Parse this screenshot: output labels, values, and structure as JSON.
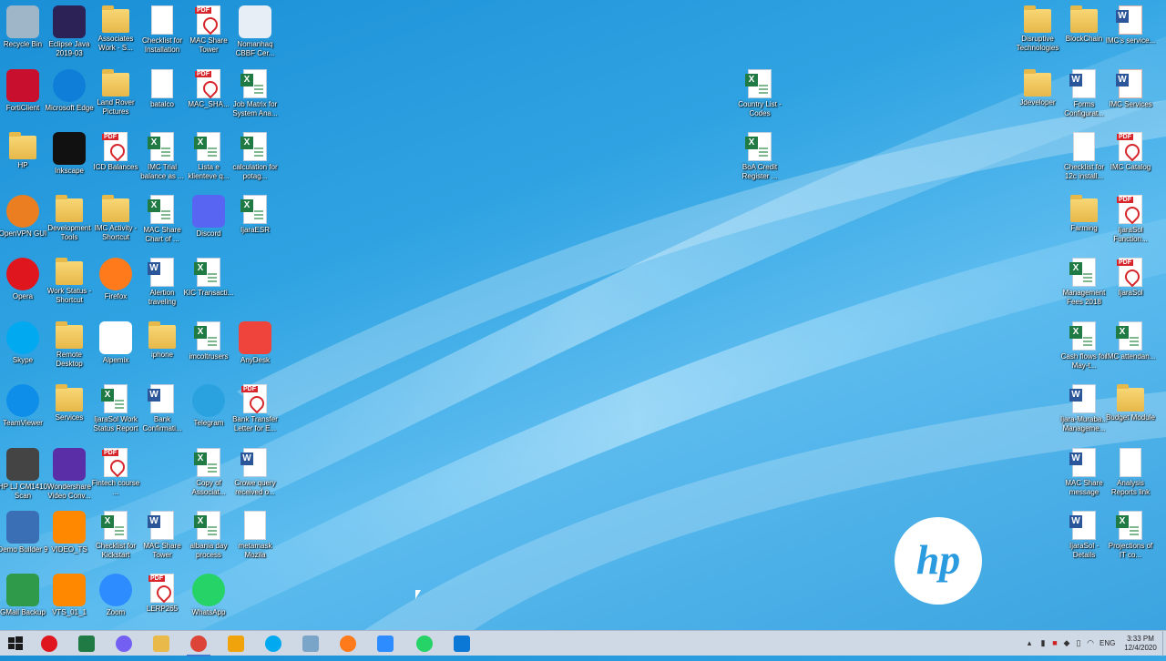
{
  "desktop": {
    "icons": [
      {
        "label": "Recycle Bin",
        "icon": "recycle-bin-icon"
      },
      {
        "label": "Eclipse Java 2019-03",
        "icon": "eclipse-icon"
      },
      {
        "label": "Associates Work - S...",
        "icon": "folder-icon"
      },
      {
        "label": "Checklist for Installation",
        "icon": "document-icon"
      },
      {
        "label": "MAC Share Tower",
        "icon": "pdf-icon"
      },
      {
        "label": "Nomanhaq CBBF Cer...",
        "icon": "certificate-icon"
      },
      {
        "label": "FortiClient",
        "icon": "forticlient-icon"
      },
      {
        "label": "Microsoft Edge",
        "icon": "edge-icon"
      },
      {
        "label": "Land Rover Pictures",
        "icon": "folder-icon"
      },
      {
        "label": "batalco",
        "icon": "document-icon"
      },
      {
        "label": "MAC_SHA...",
        "icon": "pdf-icon"
      },
      {
        "label": "Job Matrix for System Ana...",
        "icon": "excel-icon"
      },
      {
        "label": "HP",
        "icon": "folder-icon"
      },
      {
        "label": "Inkscape",
        "icon": "inkscape-icon"
      },
      {
        "label": "ICD Balances",
        "icon": "pdf-icon"
      },
      {
        "label": "IMC Trial balance as ...",
        "icon": "excel-icon"
      },
      {
        "label": "Lista e klienteve q...",
        "icon": "excel-icon"
      },
      {
        "label": "calculation for potag...",
        "icon": "excel-icon"
      },
      {
        "label": "OpenVPN GUI",
        "icon": "openvpn-icon"
      },
      {
        "label": "Development Tools",
        "icon": "folder-icon"
      },
      {
        "label": "IMC Activity - Shortcut",
        "icon": "folder-icon"
      },
      {
        "label": "MAC Share Chart of ...",
        "icon": "excel-icon"
      },
      {
        "label": "Discord",
        "icon": "discord-icon"
      },
      {
        "label": "IjaraESR",
        "icon": "excel-icon"
      },
      {
        "label": "Opera",
        "icon": "opera-icon"
      },
      {
        "label": "Work Status - Shortcut",
        "icon": "folder-icon"
      },
      {
        "label": "Firefox",
        "icon": "firefox-icon"
      },
      {
        "label": "Alertion traveling",
        "icon": "word-icon"
      },
      {
        "label": "KIC Transacti...",
        "icon": "excel-icon"
      },
      {
        "label": "Skype",
        "icon": "skype-icon"
      },
      {
        "label": "Remote Desktop",
        "icon": "folder-icon"
      },
      {
        "label": "Alpemix",
        "icon": "alpemix-icon"
      },
      {
        "label": "iphone",
        "icon": "folder-icon"
      },
      {
        "label": "imcoltrusers",
        "icon": "excel-icon"
      },
      {
        "label": "AnyDesk",
        "icon": "anydesk-icon"
      },
      {
        "label": "TeamViewer",
        "icon": "teamviewer-icon"
      },
      {
        "label": "Services",
        "icon": "folder-icon"
      },
      {
        "label": "IjaraSol Work Status Report",
        "icon": "excel-icon"
      },
      {
        "label": "Bank Confirmati...",
        "icon": "word-icon"
      },
      {
        "label": "Telegram",
        "icon": "telegram-icon"
      },
      {
        "label": "Bank Transfer Letter for E...",
        "icon": "pdf-icon"
      },
      {
        "label": "HP LJ CM1410 Scan",
        "icon": "scanner-icon"
      },
      {
        "label": "Wondershare Video Conv...",
        "icon": "wondershare-icon"
      },
      {
        "label": "Fintech course ...",
        "icon": "pdf-icon"
      },
      {
        "label": "Copy of Associat...",
        "icon": "excel-icon"
      },
      {
        "label": "Crowe query received o...",
        "icon": "word-icon"
      },
      {
        "label": "Demo Builder 9",
        "icon": "demo-builder-icon"
      },
      {
        "label": "VIDEO_TS",
        "icon": "vlc-icon"
      },
      {
        "label": "Checklist for Kickstart",
        "icon": "excel-icon"
      },
      {
        "label": "MAC Share Tower",
        "icon": "word-icon"
      },
      {
        "label": "albania day process",
        "icon": "excel-icon"
      },
      {
        "label": "metamask Mozila",
        "icon": "document-icon"
      },
      {
        "label": "GMail Backup",
        "icon": "gmail-backup-icon"
      },
      {
        "label": "VTS_01_1",
        "icon": "vlc-icon"
      },
      {
        "label": "Zoom",
        "icon": "zoom-icon"
      },
      {
        "label": "LERP265",
        "icon": "pdf-icon"
      },
      {
        "label": "WhatsApp",
        "icon": "whatsapp-icon"
      },
      {
        "label": "Country List - Codes",
        "icon": "excel-icon"
      },
      {
        "label": "BoA Credit Register ...",
        "icon": "excel-icon"
      },
      {
        "label": "Disruptive Technologies",
        "icon": "folder-icon"
      },
      {
        "label": "BlockChain",
        "icon": "folder-icon"
      },
      {
        "label": "IMC's service...",
        "icon": "powerpoint-icon"
      },
      {
        "label": "Jdeveloper",
        "icon": "folder-icon"
      },
      {
        "label": "Forms Configurat...",
        "icon": "word-icon"
      },
      {
        "label": "IMC Services",
        "icon": "powerpoint-icon"
      },
      {
        "label": "Checklist for 12c install...",
        "icon": "document-icon"
      },
      {
        "label": "IMC Catalog",
        "icon": "pdf-icon"
      },
      {
        "label": "Farming",
        "icon": "folder-icon"
      },
      {
        "label": "IjaraSol Function...",
        "icon": "pdf-icon"
      },
      {
        "label": "Management Fees 2018",
        "icon": "excel-icon"
      },
      {
        "label": "IjaraSol",
        "icon": "pdf-icon"
      },
      {
        "label": "Cash flows for May-t...",
        "icon": "excel-icon"
      },
      {
        "label": "IMC attendan...",
        "icon": "excel-icon"
      },
      {
        "label": "Ijara-Muraba... Manageme...",
        "icon": "word-icon"
      },
      {
        "label": "Budget Module",
        "icon": "folder-icon"
      },
      {
        "label": "MAC Share message",
        "icon": "word-icon"
      },
      {
        "label": "Analysis Reports link",
        "icon": "document-icon"
      },
      {
        "label": "IjaraSol - Details",
        "icon": "word-icon"
      },
      {
        "label": "Projections of IT co...",
        "icon": "excel-icon"
      }
    ]
  },
  "taskbar": {
    "start_icon": "windows-start-icon",
    "items": [
      {
        "name": "opera-icon"
      },
      {
        "name": "excel-app-icon"
      },
      {
        "name": "viber-icon"
      },
      {
        "name": "file-explorer-icon"
      },
      {
        "name": "chrome-icon"
      },
      {
        "name": "outlook-icon"
      },
      {
        "name": "skype-icon"
      },
      {
        "name": "app-grid-icon"
      },
      {
        "name": "firefox-icon"
      },
      {
        "name": "zoom-icon"
      },
      {
        "name": "whatsapp-icon"
      },
      {
        "name": "vscode-icon"
      }
    ],
    "language": "ENG",
    "time": "3:33 PM",
    "date": "12/4/2020"
  },
  "colors": {
    "taskbar": "#cfd9e6",
    "accent": "#3b7bd4",
    "desktop": "#2fa3e2"
  }
}
